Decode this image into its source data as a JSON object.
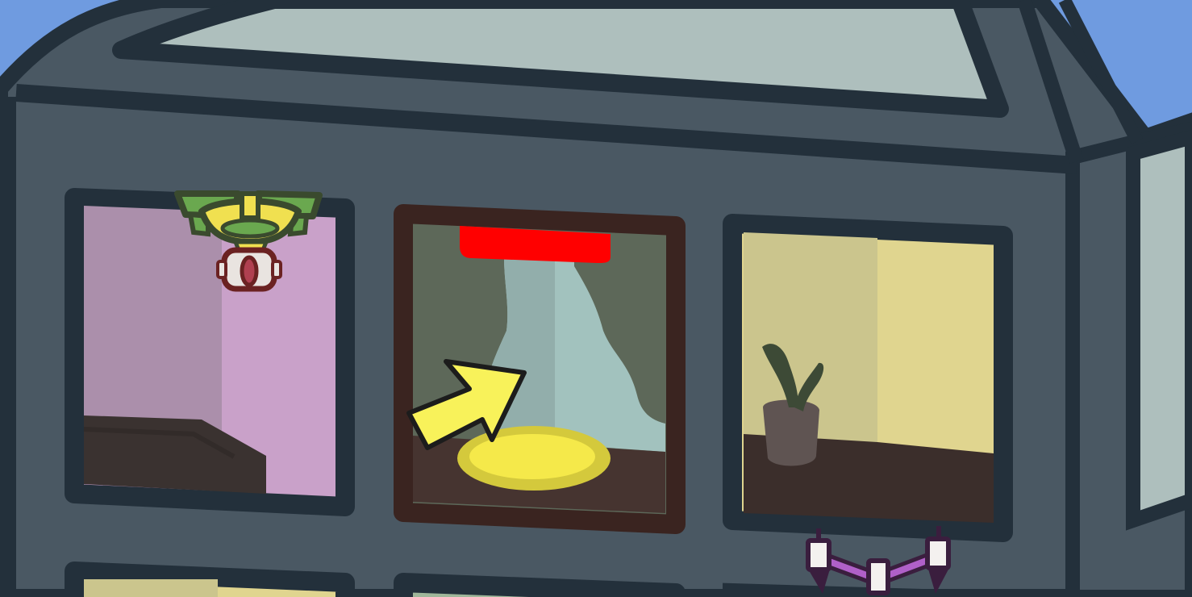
{
  "scene": {
    "kind": "game-scene",
    "description_hidden": "",
    "colors": {
      "sky": "#6f9be0",
      "building": "#4a5863",
      "outline": "#23303b",
      "roof_glass": "#aebfbd",
      "room_left_wall": "#c9a1c9",
      "room_right_wall": "#e0d58f",
      "beam": "#ff0000",
      "target_pad": "#f5e94a",
      "cursor": "#f8f25a",
      "drone_green": "#6aa84f",
      "drone_yellow": "#f0e050",
      "drone_purple": "#b060c8"
    },
    "icons": {
      "cursor": "arrow-cursor-icon",
      "drone_top": "green-drone-icon",
      "drone_bottom": "purple-drone-icon",
      "plant": "potted-plant-icon",
      "cloud": "cloud-icon",
      "teleporter": "teleporter-pad-icon"
    }
  }
}
